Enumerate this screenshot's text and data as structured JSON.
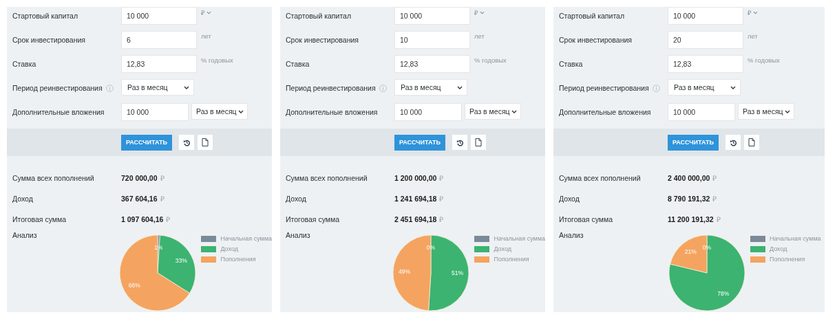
{
  "panels": [
    {
      "fields": [
        {
          "kind": "currency",
          "label": "Стартовый капитал",
          "value": "10 000",
          "unit": "₽"
        },
        {
          "kind": "input",
          "label": "Срок инвестирования",
          "value": "6",
          "unit": "лет"
        },
        {
          "kind": "input",
          "label": "Ставка",
          "value": "12,83",
          "unit": "% годовых"
        },
        {
          "kind": "select",
          "label": "Период реинвестирования",
          "value": "Раз в месяц",
          "info": true
        },
        {
          "kind": "input_select",
          "label": "Дополнительные вложения",
          "value": "10 000",
          "option": "Раз в месяц"
        }
      ],
      "calculate_button": "РАССЧИТАТЬ",
      "results": [
        {
          "label": "Сумма всех пополнений",
          "value": "720 000,00",
          "currency": "₽"
        },
        {
          "label": "Доход",
          "value": "367 604,16",
          "currency": "₽"
        },
        {
          "label": "Итоговая сумма",
          "value": "1 097 604,16",
          "currency": "₽"
        }
      ],
      "analysis_label": "Анализ",
      "chart_data": {
        "type": "pie",
        "legend": "right",
        "categories": [
          "Начальная сумма",
          "Доход",
          "Пополнения"
        ],
        "colors": [
          "#7c8a98",
          "#3cb371",
          "#f4a460"
        ],
        "values": [
          1,
          33,
          66
        ],
        "value_labels": [
          "1%",
          "33%",
          "66%"
        ]
      }
    },
    {
      "fields": [
        {
          "kind": "currency",
          "label": "Стартовый капитал",
          "value": "10 000",
          "unit": "₽"
        },
        {
          "kind": "input",
          "label": "Срок инвестирования",
          "value": "10",
          "unit": "лет"
        },
        {
          "kind": "input",
          "label": "Ставка",
          "value": "12,83",
          "unit": "% годовых"
        },
        {
          "kind": "select",
          "label": "Период реинвестирования",
          "value": "Раз в месяц",
          "info": true
        },
        {
          "kind": "input_select",
          "label": "Дополнительные вложения",
          "value": "10 000",
          "option": "Раз в месяц"
        }
      ],
      "calculate_button": "РАССЧИТАТЬ",
      "results": [
        {
          "label": "Сумма всех пополнений",
          "value": "1 200 000,00",
          "currency": "₽"
        },
        {
          "label": "Доход",
          "value": "1 241 694,18",
          "currency": "₽"
        },
        {
          "label": "Итоговая сумма",
          "value": "2 451 694,18",
          "currency": "₽"
        }
      ],
      "analysis_label": "Анализ",
      "chart_data": {
        "type": "pie",
        "legend": "right",
        "categories": [
          "Начальная сумма",
          "Доход",
          "Пополнения"
        ],
        "colors": [
          "#7c8a98",
          "#3cb371",
          "#f4a460"
        ],
        "values": [
          0,
          51,
          49
        ],
        "value_labels": [
          "0%",
          "51%",
          "49%"
        ]
      }
    },
    {
      "fields": [
        {
          "kind": "currency",
          "label": "Стартовый капитал",
          "value": "10 000",
          "unit": "₽"
        },
        {
          "kind": "input",
          "label": "Срок инвестирования",
          "value": "20",
          "unit": "лет"
        },
        {
          "kind": "input",
          "label": "Ставка",
          "value": "12,83",
          "unit": "% годовых"
        },
        {
          "kind": "select",
          "label": "Период реинвестирования",
          "value": "Раз в месяц",
          "info": true
        },
        {
          "kind": "input_select",
          "label": "Дополнительные вложения",
          "value": "10 000",
          "option": "Раз в месяц"
        }
      ],
      "calculate_button": "РАССЧИТАТЬ",
      "results": [
        {
          "label": "Сумма всех пополнений",
          "value": "2 400 000,00",
          "currency": "₽"
        },
        {
          "label": "Доход",
          "value": "8 790 191,32",
          "currency": "₽"
        },
        {
          "label": "Итоговая сумма",
          "value": "11 200 191,32",
          "currency": "₽"
        }
      ],
      "analysis_label": "Анализ",
      "chart_data": {
        "type": "pie",
        "legend": "right",
        "categories": [
          "Начальная сумма",
          "Доход",
          "Пополнения"
        ],
        "colors": [
          "#7c8a98",
          "#3cb371",
          "#f4a460"
        ],
        "values": [
          0,
          78,
          21
        ],
        "value_labels": [
          "0%",
          "78%",
          "21%"
        ]
      }
    }
  ]
}
